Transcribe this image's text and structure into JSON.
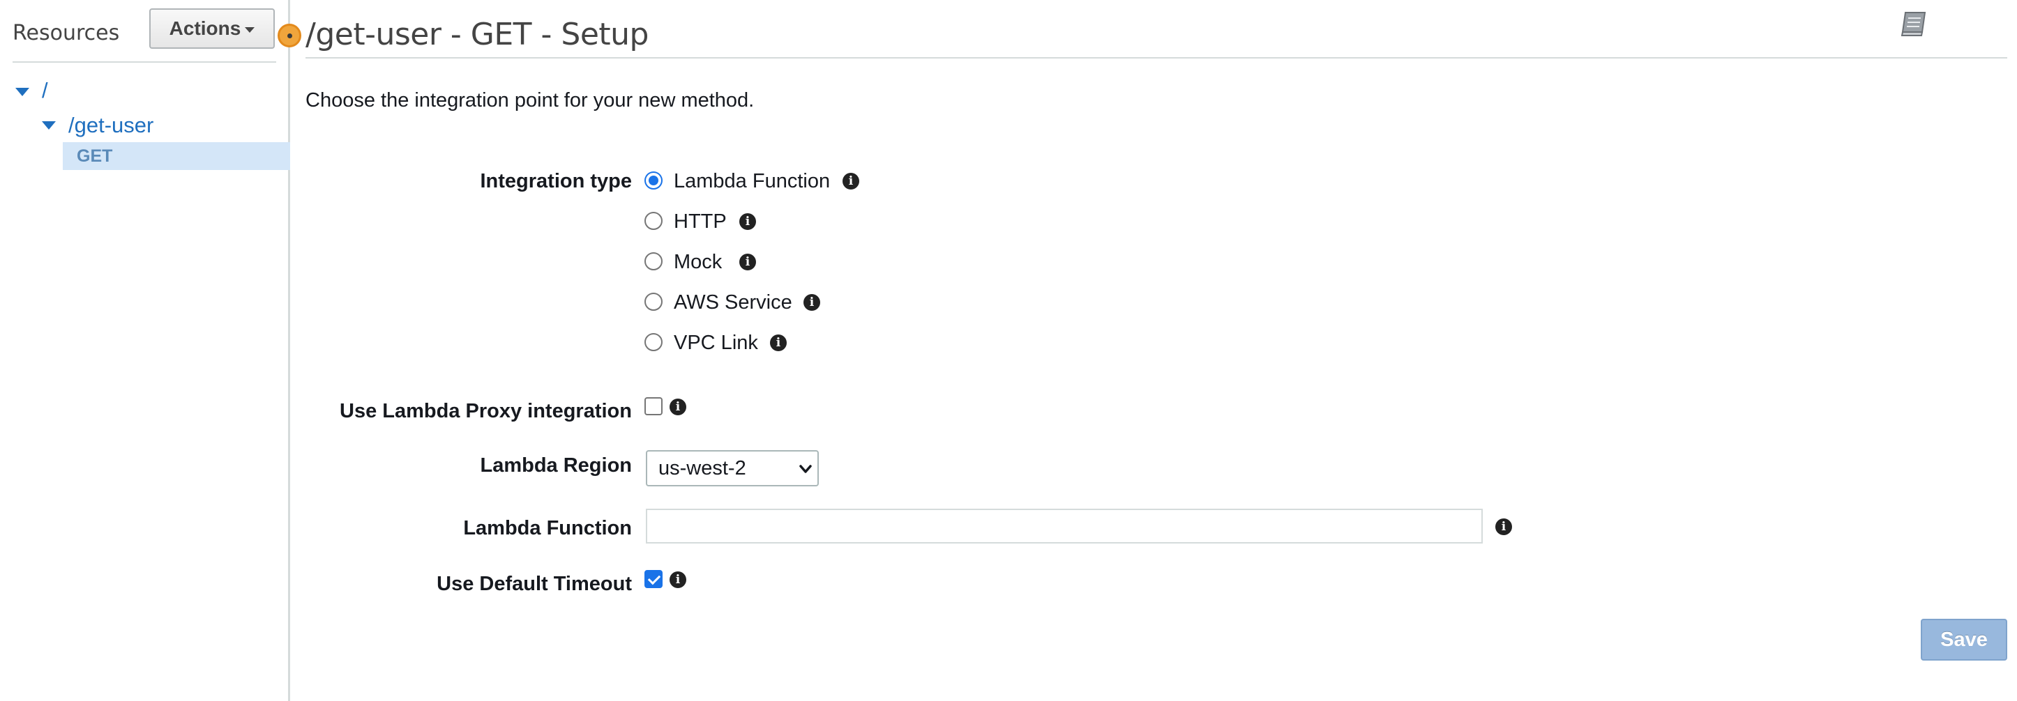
{
  "sidebar": {
    "title": "Resources",
    "actions_label": "Actions",
    "tree": {
      "root": "/",
      "resource": "/get-user",
      "method": "GET"
    }
  },
  "header": {
    "title": "/get-user - GET - Setup"
  },
  "main": {
    "description": "Choose the integration point for your new method.",
    "integration_type": {
      "label": "Integration type",
      "selected": "Lambda Function",
      "options": [
        "Lambda Function",
        "HTTP",
        "Mock",
        "AWS Service",
        "VPC Link"
      ]
    },
    "lambda_proxy": {
      "label": "Use Lambda Proxy integration",
      "checked": false
    },
    "lambda_region": {
      "label": "Lambda Region",
      "value": "us-west-2"
    },
    "lambda_function": {
      "label": "Lambda Function",
      "value": "",
      "placeholder": ""
    },
    "default_timeout": {
      "label": "Use Default Timeout",
      "checked": true
    },
    "save_label": "Save"
  },
  "icons": {
    "info": "info-icon",
    "docs": "book-icon"
  },
  "colors": {
    "link": "#1f6fbf",
    "selected_row": "#d4e6f8",
    "accent": "#1a73e8",
    "save_button": "#98b8dd",
    "resize_handle": "#f0a53c"
  }
}
